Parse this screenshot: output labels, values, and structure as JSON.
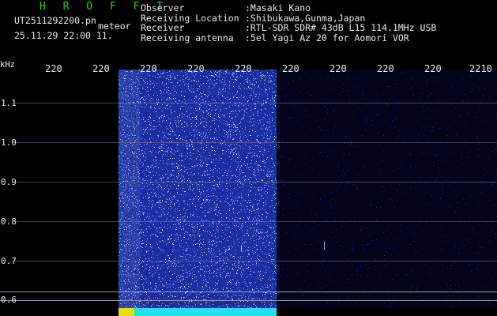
{
  "header": {
    "brand": "H R O F F T",
    "filename": "UT2511292200.pn",
    "tag": "meteor",
    "timestamp": "25.11.29 22:00   11.",
    "fields": [
      {
        "key": "Observer",
        "value": ":Masaki Kano"
      },
      {
        "key": "Receiving Location",
        "value": ":Shibukawa,Gunma,Japan"
      },
      {
        "key": "Receiver",
        "value": ":RTL-SDR SDR# 43dB L15 114.1MHz USB"
      },
      {
        "key": "Receiving antenna",
        "value": ":5el Yagi Az 20 for Aomori VOR"
      }
    ]
  },
  "axis": {
    "unit": "kHz",
    "x_ticks": [
      "220",
      "220",
      "220",
      "220",
      "220",
      "220",
      "220",
      "220",
      "220",
      "2210"
    ],
    "y_ticks": [
      "1.1",
      "1.0",
      "0.9",
      "0.8",
      "0.7",
      "0.6"
    ]
  },
  "colors": {
    "background": "#000000",
    "signal": "#1b2ea0",
    "brand": "#2ecc2e",
    "text": "#e7e7e7"
  }
}
